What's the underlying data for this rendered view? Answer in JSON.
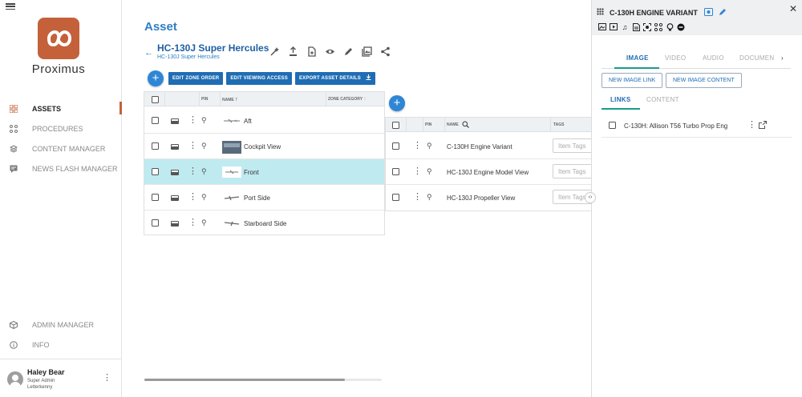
{
  "sidebar": {
    "brand": "Proximus",
    "nav": [
      {
        "label": "ASSETS",
        "icon": "grid-icon"
      },
      {
        "label": "PROCEDURES",
        "icon": "procedures-icon"
      },
      {
        "label": "CONTENT MANAGER",
        "icon": "layers-icon"
      },
      {
        "label": "NEWS FLASH MANAGER",
        "icon": "chat-icon"
      }
    ],
    "bottom_nav": [
      {
        "label": "ADMIN MANAGER",
        "icon": "cube-icon"
      },
      {
        "label": "INFO",
        "icon": "info-icon"
      }
    ],
    "user": {
      "name": "Haley Bear",
      "role": "Super Admin",
      "site": "Letterkenny"
    }
  },
  "main": {
    "title": "Asset",
    "asset_name": "HC-130J Super Hercules",
    "asset_subtitle": "HC-130J Super Hercules",
    "actions": [
      "EDIT ZONE ORDER",
      "EDIT VIEWING ACCESS",
      "EXPORT ASSET DETAILS"
    ],
    "zones_table": {
      "headers": {
        "pin": "PIN",
        "name": "NAME",
        "zone_category": "ZONE CATEGORY"
      },
      "rows": [
        {
          "name": "Aft",
          "selected": false
        },
        {
          "name": "Cockpit View",
          "selected": false
        },
        {
          "name": "Front",
          "selected": true
        },
        {
          "name": "Port Side",
          "selected": false
        },
        {
          "name": "Starboard Side",
          "selected": false
        }
      ]
    },
    "subzones_table": {
      "headers": {
        "pin": "PIN",
        "name": "NAME",
        "tags": "TAGS"
      },
      "tag_placeholder": "Item Tags",
      "rows": [
        {
          "name": "C-130H Engine Variant"
        },
        {
          "name": "HC-130J Engine Model View"
        },
        {
          "name": "HC-130J Propeller View"
        }
      ]
    }
  },
  "panel": {
    "title": "C-130H ENGINE VARIANT",
    "tabs": [
      "IMAGE",
      "VIDEO",
      "AUDIO",
      "DOCUMEN"
    ],
    "active_tab": "IMAGE",
    "buttons": [
      "NEW IMAGE LINK",
      "NEW IMAGE CONTENT"
    ],
    "subtabs": [
      "LINKS",
      "CONTENT"
    ],
    "active_subtab": "LINKS",
    "links": [
      {
        "name": "C-130H: Allison T56 Turbo Prop Eng"
      }
    ]
  },
  "colors": {
    "brand": "#c4613a",
    "primary": "#1f6db3",
    "accent_teal": "#1a9c8a",
    "selected_row": "#bfeaf0"
  }
}
